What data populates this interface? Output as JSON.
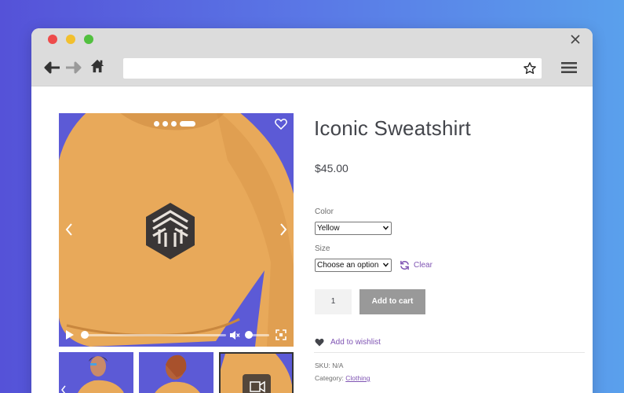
{
  "browser": {
    "url": "",
    "icons": {
      "close": "close-icon",
      "back": "back-arrow-icon",
      "forward": "forward-arrow-icon",
      "home": "home-icon",
      "bookmark": "star-icon",
      "menu": "hamburger-menu-icon"
    }
  },
  "product": {
    "title": "Iconic Sweatshirt",
    "price": "$45.00",
    "color_label": "Color",
    "color_value": "Yellow",
    "size_label": "Size",
    "size_value": "Choose an option",
    "clear_label": "Clear",
    "quantity": "1",
    "add_to_cart_label": "Add to cart",
    "wishlist_label": "Add to wishlist",
    "sku_label": "SKU:",
    "sku_value": "N/A",
    "category_label": "Category:",
    "category_value": "Clothing"
  },
  "gallery": {
    "slide_count": 4,
    "active_slide": 4,
    "thumbnails": [
      "model-front",
      "model-back",
      "sweatshirt-video"
    ]
  },
  "colors": {
    "accent": "#7f54b3",
    "gallery_bg": "#5c5ad6",
    "sweater": "#e8a95a",
    "add_to_cart_bg": "#999999"
  }
}
